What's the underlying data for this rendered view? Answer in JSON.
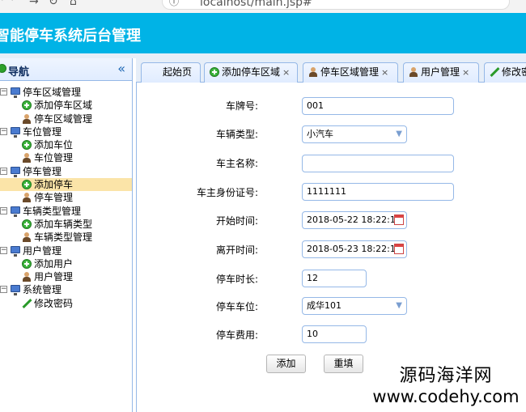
{
  "browser": {
    "url": "localhost/main.jsp#"
  },
  "header": {
    "title": "智能停车系统后台管理"
  },
  "sidebar": {
    "title": "导航",
    "collapse_glyph": "«",
    "tree": [
      {
        "label": "停车区域管理",
        "icon": "pc-icon",
        "level": 0
      },
      {
        "label": "添加停车区域",
        "icon": "add-icon",
        "level": 1
      },
      {
        "label": "停车区域管理",
        "icon": "user-icon",
        "level": 1
      },
      {
        "label": "车位管理",
        "icon": "pc-icon",
        "level": 0
      },
      {
        "label": "添加车位",
        "icon": "add-icon",
        "level": 1
      },
      {
        "label": "车位管理",
        "icon": "user-icon",
        "level": 1
      },
      {
        "label": "停车管理",
        "icon": "pc-icon",
        "level": 0
      },
      {
        "label": "添加停车",
        "icon": "add-icon",
        "level": 1,
        "selected": true
      },
      {
        "label": "停车管理",
        "icon": "user-icon",
        "level": 1
      },
      {
        "label": "车辆类型管理",
        "icon": "pc-icon",
        "level": 0
      },
      {
        "label": "添加车辆类型",
        "icon": "add-icon",
        "level": 1
      },
      {
        "label": "车辆类型管理",
        "icon": "user-icon",
        "level": 1
      },
      {
        "label": "用户管理",
        "icon": "pc-icon",
        "level": 0
      },
      {
        "label": "添加用户",
        "icon": "add-icon",
        "level": 1
      },
      {
        "label": "用户管理",
        "icon": "user-icon",
        "level": 1
      },
      {
        "label": "系统管理",
        "icon": "pc-icon",
        "level": 0
      },
      {
        "label": "修改密码",
        "icon": "pen-icon",
        "level": 1
      }
    ]
  },
  "tabs": [
    {
      "label": "起始页",
      "icon": "",
      "closable": false
    },
    {
      "label": "添加停车区域",
      "icon": "add-icon",
      "closable": true
    },
    {
      "label": "停车区域管理",
      "icon": "user-icon",
      "closable": true
    },
    {
      "label": "用户管理",
      "icon": "user-icon",
      "closable": true
    },
    {
      "label": "修改密",
      "icon": "pen-icon",
      "closable": false
    }
  ],
  "form": {
    "plate_label": "车牌号:",
    "plate_value": "001",
    "type_label": "车辆类型:",
    "type_value": "小汽车",
    "owner_label": "车主名称:",
    "owner_value": "",
    "id_label": "车主身份证号:",
    "id_value": "1111111",
    "start_label": "开始时间:",
    "start_value": "2018-05-22 18:22:1",
    "end_label": "离开时间:",
    "end_value": "2018-05-23 18:22:1",
    "duration_label": "停车时长:",
    "duration_value": "12",
    "space_label": "停车车位:",
    "space_value": "成华101",
    "fee_label": "停车费用:",
    "fee_value": "10",
    "add_button": "添加",
    "reset_button": "重填"
  },
  "watermark": {
    "cn": "源码海洋网",
    "en": "www.codehy.com"
  }
}
